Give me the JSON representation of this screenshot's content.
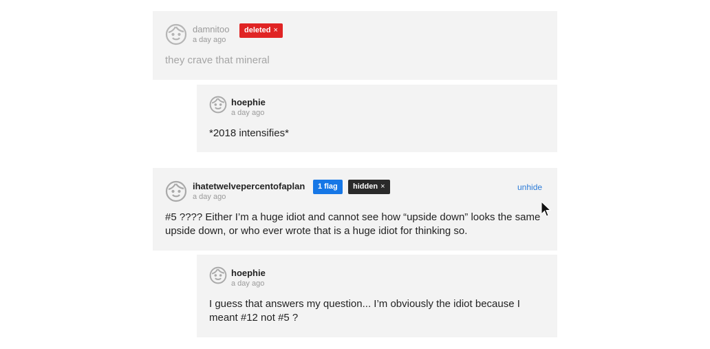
{
  "comments": [
    {
      "username": "damnitoo",
      "time": "a day ago",
      "badge": {
        "label": "deleted",
        "close": "×"
      },
      "body": "they crave that mineral"
    },
    {
      "username": "hoephie",
      "time": "a day ago",
      "body": "*2018 intensifies*"
    },
    {
      "username": "ihatetwelvepercentofaplan",
      "time": "a day ago",
      "flag_badge": "1 flag",
      "hidden_badge": {
        "label": "hidden",
        "close": "×"
      },
      "action": "unhide",
      "body": "#5 ???? Either I’m a huge idiot and cannot see how “upside down” looks the same upside down, or who ever wrote that is a huge idiot for thinking so."
    },
    {
      "username": "hoephie",
      "time": "a day ago",
      "body": "I guess that answers my question... I’m obviously the idiot because I meant #12 not #5 ?"
    }
  ],
  "colors": {
    "card_bg": "#f3f3f3",
    "deleted_badge": "#e02424",
    "flag_badge": "#1677e6",
    "hidden_badge": "#2a2a2a",
    "link": "#2b7bd8"
  },
  "icons": {
    "avatar": "face-avatar-icon",
    "cursor": "mouse-pointer-icon"
  }
}
